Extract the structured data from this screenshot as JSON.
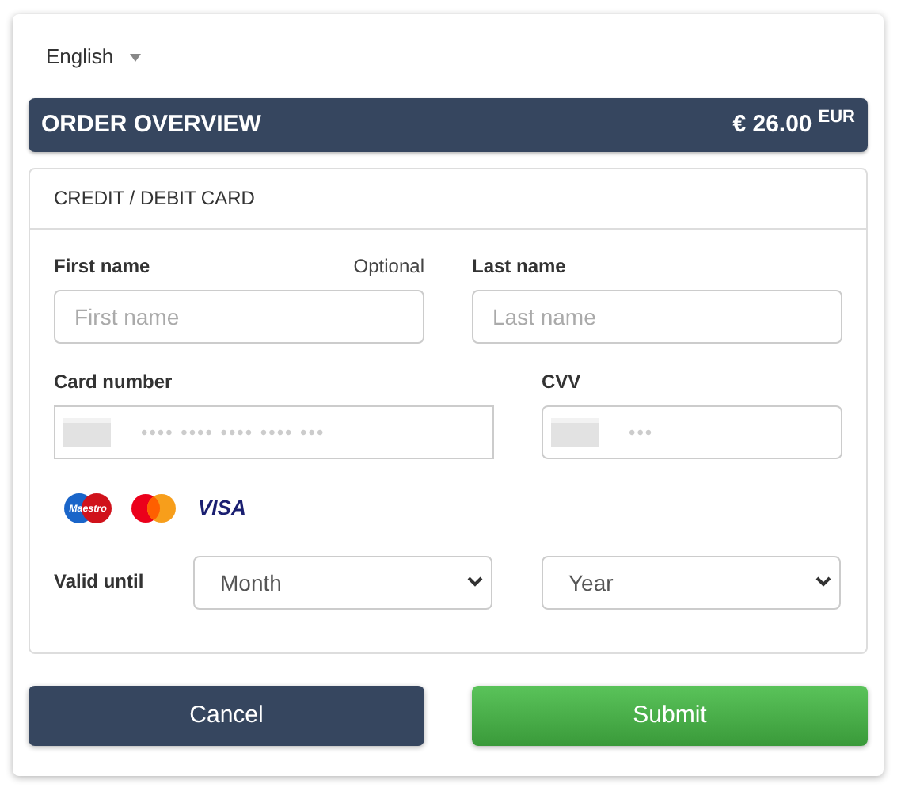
{
  "language": {
    "value": "English"
  },
  "order": {
    "title": "ORDER OVERVIEW",
    "amount": "€ 26.00",
    "currency": "EUR"
  },
  "payment_card": {
    "title": "CREDIT / DEBIT CARD",
    "first_name": {
      "label": "First name",
      "note": "Optional",
      "placeholder": "First name"
    },
    "last_name": {
      "label": "Last name",
      "placeholder": "Last name"
    },
    "card_number": {
      "label": "Card number",
      "placeholder": "•••• •••• •••• •••• •••"
    },
    "cvv": {
      "label": "CVV",
      "placeholder": "•••"
    },
    "brands": [
      {
        "kind": "maestro",
        "label": "Maestro"
      },
      {
        "kind": "mastercard"
      },
      {
        "kind": "visa",
        "label": "VISA"
      }
    ],
    "valid_until": {
      "label": "Valid until",
      "month": "Month",
      "year": "Year"
    }
  },
  "buttons": [
    {
      "kind": "cancel",
      "label": "Cancel"
    },
    {
      "kind": "submit",
      "label": "Submit"
    }
  ]
}
